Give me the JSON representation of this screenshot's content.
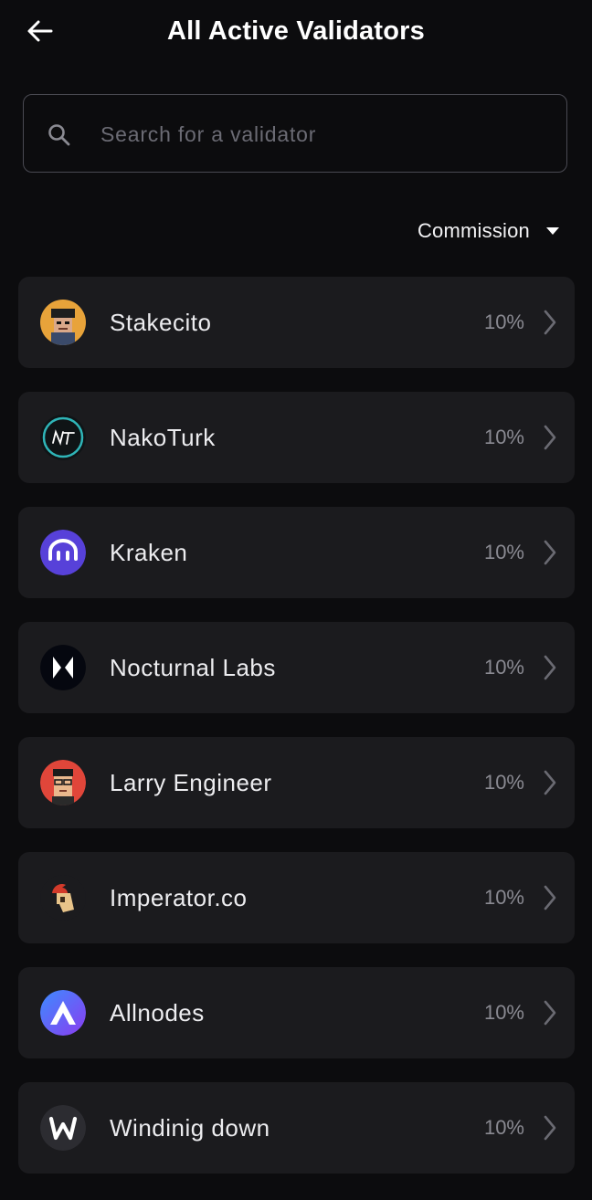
{
  "header": {
    "title": "All Active Validators",
    "back_icon": "arrow-left-icon"
  },
  "search": {
    "placeholder": "Search for a validator",
    "value": "",
    "icon": "search-icon"
  },
  "sort": {
    "label": "Commission",
    "icon": "caret-down-icon"
  },
  "validators": [
    {
      "name": "Stakecito",
      "commission": "10%"
    },
    {
      "name": "NakoTurk",
      "commission": "10%"
    },
    {
      "name": "Kraken",
      "commission": "10%"
    },
    {
      "name": "Nocturnal Labs",
      "commission": "10%"
    },
    {
      "name": "Larry Engineer",
      "commission": "10%"
    },
    {
      "name": "Imperator.co",
      "commission": "10%"
    },
    {
      "name": "Allnodes",
      "commission": "10%"
    },
    {
      "name": "Windinig down",
      "commission": "10%"
    }
  ],
  "colors": {
    "background": "#0c0c0e",
    "card": "#1b1b1e",
    "muted_text": "#8a8a92",
    "kraken_purple": "#5741d9"
  }
}
